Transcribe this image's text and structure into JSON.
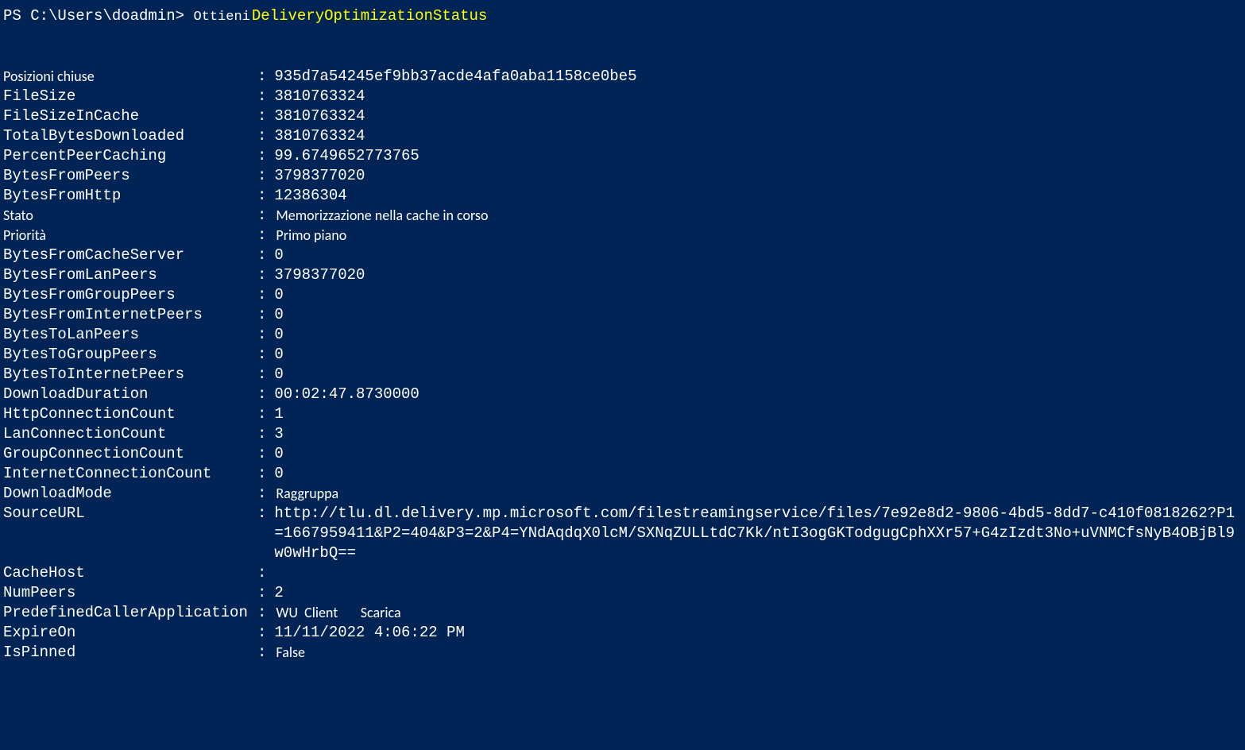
{
  "prompt": {
    "prefix": "PS C:\\Users\\doadmin> ",
    "cmd1": "Ottieni",
    "cmd2": "DeliveryOptimizationStatus"
  },
  "rows": [
    {
      "label": "Posizioni chiuse",
      "labelSans": true,
      "value": "935d7a54245ef9bb37acde4afa0aba1158ce0be5"
    },
    {
      "label": "FileSize",
      "value": "3810763324"
    },
    {
      "label": "FileSizeInCache",
      "value": "3810763324"
    },
    {
      "label": "TotalBytesDownloaded",
      "value": "3810763324"
    },
    {
      "label": "PercentPeerCaching",
      "value": "99.6749652773765"
    },
    {
      "label": "BytesFromPeers",
      "value": "3798377020"
    },
    {
      "label": "BytesFromHttp",
      "value": "12386304"
    },
    {
      "label": "Stato",
      "labelSans": true,
      "value": "Memorizzazione nella cache in corso",
      "valueSans": true
    },
    {
      "label": "Priorità",
      "labelSans": true,
      "value": "Primo piano",
      "valueSans": true
    },
    {
      "label": "BytesFromCacheServer",
      "value": "0"
    },
    {
      "label": "BytesFromLanPeers",
      "value": "3798377020"
    },
    {
      "label": "BytesFromGroupPeers",
      "value": "0"
    },
    {
      "label": "BytesFromInternetPeers",
      "value": "0"
    },
    {
      "label": "BytesToLanPeers",
      "value": "0"
    },
    {
      "label": "BytesToGroupPeers",
      "value": "0"
    },
    {
      "label": "BytesToInternetPeers",
      "value": "0"
    },
    {
      "label": "DownloadDuration",
      "value": "00:02:47.8730000"
    },
    {
      "label": "HttpConnectionCount",
      "value": "1"
    },
    {
      "label": "LanConnectionCount",
      "value": "3"
    },
    {
      "label": "GroupConnectionCount",
      "value": "0"
    },
    {
      "label": "InternetConnectionCount",
      "value": "0"
    },
    {
      "label": "DownloadMode",
      "value": "Raggruppa",
      "valueSans": true
    },
    {
      "label": "SourceURL",
      "value": "http://tlu.dl.delivery.mp.microsoft.com/filestreamingservice/files/7e92e8d2-9806-4bd5-8dd7-c410f0818262?P1=1667959411&P2=404&P3=2&P4=YNdAqdqX0lcM/SXNqZULLtdC7Kk/ntI3ogGKTodgugCphXXr57+G4zIzdt3No+uVNMCfsNyB4OBjBl9w0wHrbQ=="
    },
    {
      "label": "CacheHost",
      "value": ""
    },
    {
      "label": "NumPeers",
      "value": "2"
    },
    {
      "label": "PredefinedCallerApplication",
      "value": "WU  Client       Scarica",
      "valueSans": true
    },
    {
      "label": "ExpireOn",
      "value": "11/11/2022 4:06:22 PM"
    },
    {
      "label": "IsPinned",
      "value": "False",
      "valueSans": true
    }
  ]
}
